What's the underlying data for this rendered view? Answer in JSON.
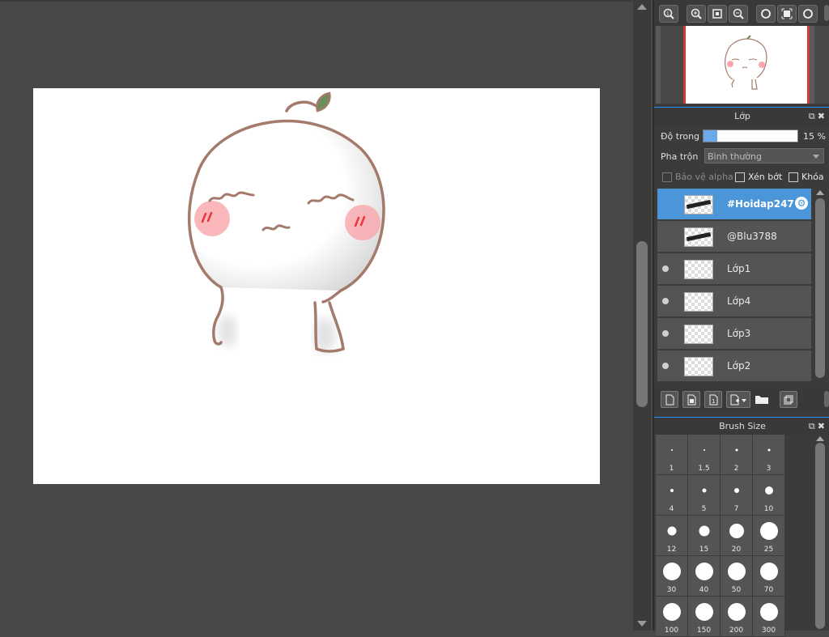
{
  "navigator": {
    "tools": [
      {
        "icon": "zoom-actual-icon"
      },
      {
        "icon": "zoom-in-icon"
      },
      {
        "icon": "fit-screen-icon"
      },
      {
        "icon": "zoom-out-icon"
      },
      {
        "icon": "rotate-left-icon"
      },
      {
        "icon": "reset-view-icon"
      },
      {
        "icon": "rotate-right-icon"
      }
    ]
  },
  "layer_panel": {
    "title": "Lớp",
    "opacity_label": "Độ trong",
    "opacity_value": "15 %",
    "opacity_percent": 15,
    "blend_label": "Pha trộn",
    "blend_value": "Bình thường",
    "options": {
      "protect_alpha": "Bảo vệ alpha",
      "clipping": "Xén bớt",
      "lock": "Khóa"
    },
    "layers": [
      {
        "name": "#Hoidap247",
        "selected": true,
        "visible": false
      },
      {
        "name": "@Blu3788",
        "selected": false,
        "visible": false
      },
      {
        "name": "Lớp1",
        "selected": false,
        "visible": true
      },
      {
        "name": "Lớp4",
        "selected": false,
        "visible": true
      },
      {
        "name": "Lớp3",
        "selected": false,
        "visible": true
      },
      {
        "name": "Lớp2",
        "selected": false,
        "visible": true
      }
    ],
    "tools": [
      {
        "icon": "new-layer-icon"
      },
      {
        "icon": "new-halftone-layer-icon"
      },
      {
        "icon": "new-1bit-layer-icon"
      },
      {
        "icon": "add-layer-menu-icon"
      },
      {
        "icon": "new-folder-icon"
      },
      {
        "icon": "duplicate-layer-icon"
      }
    ]
  },
  "brush_panel": {
    "title": "Brush Size",
    "sizes": [
      "1",
      "1.5",
      "2",
      "3",
      "4",
      "5",
      "7",
      "10",
      "12",
      "15",
      "20",
      "25",
      "30",
      "40",
      "50",
      "70",
      "100",
      "150",
      "200",
      "300"
    ]
  },
  "colors": {
    "accent": "#4a96d8",
    "stroke": "#a47a6c",
    "blush": "#f9a6ad"
  }
}
